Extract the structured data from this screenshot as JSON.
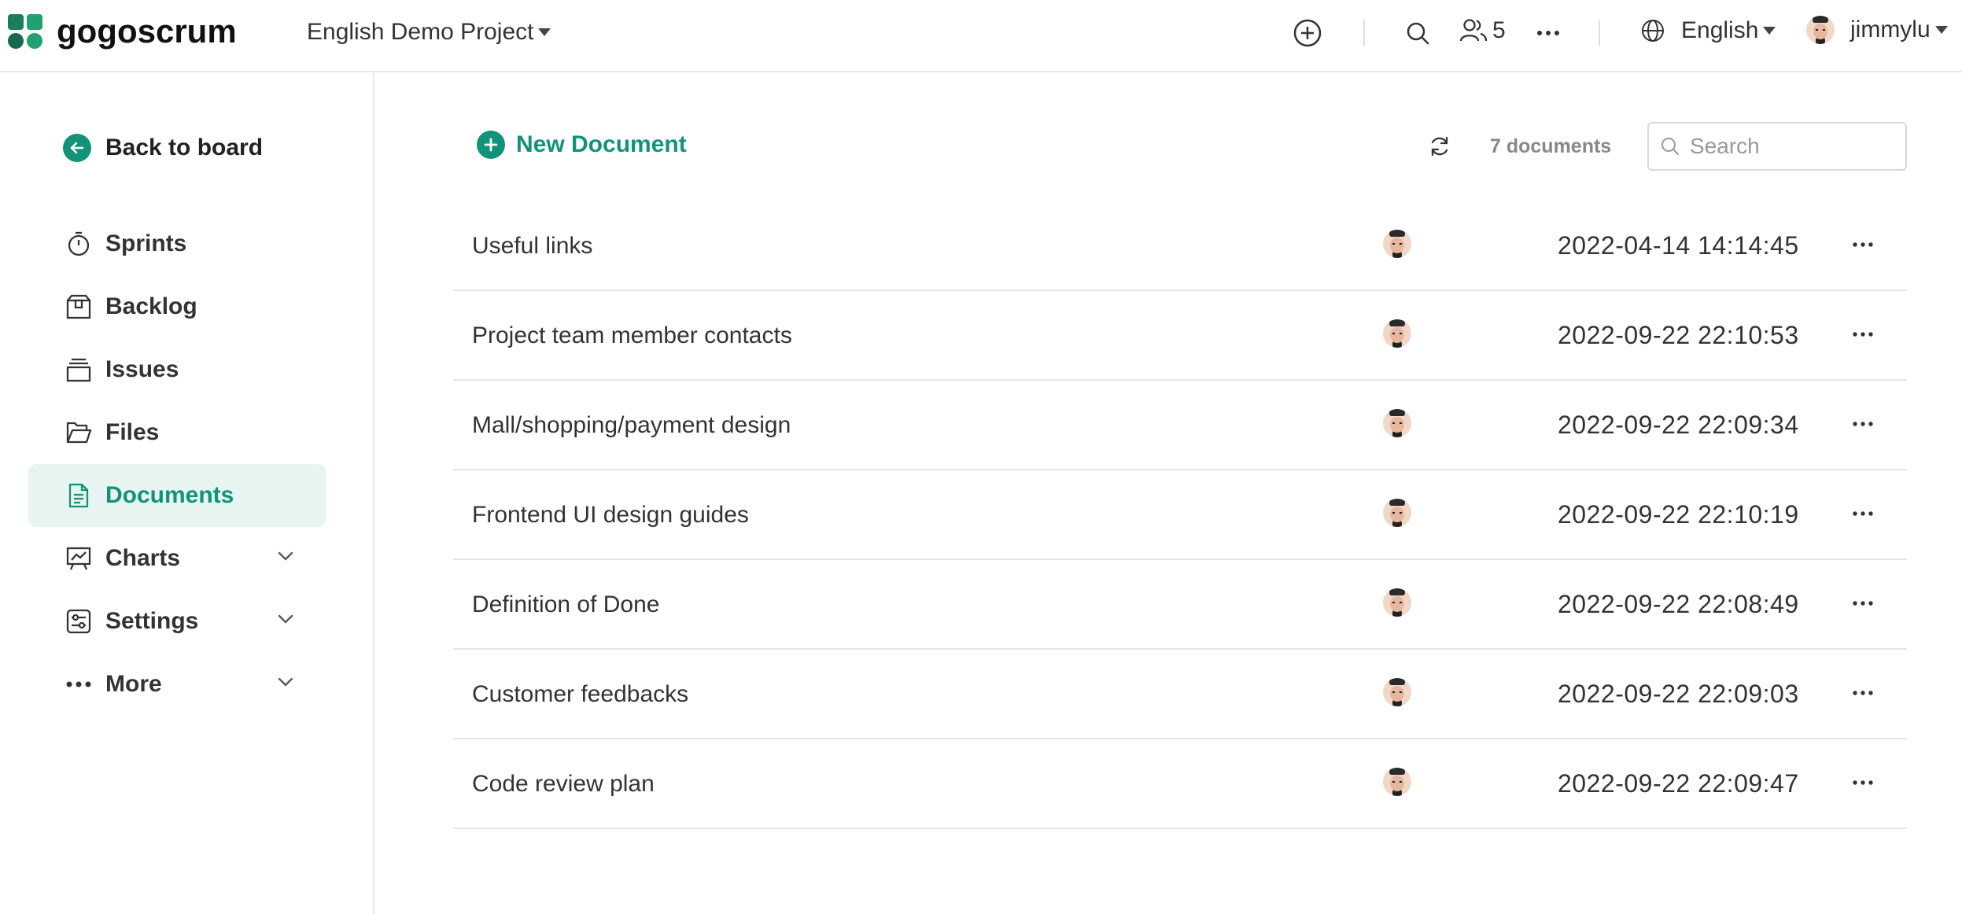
{
  "app": {
    "brand": "gogoscrum"
  },
  "header": {
    "project": "English Demo Project",
    "member_count": "5",
    "language": "English",
    "username": "jimmylu"
  },
  "sidebar": {
    "back_label": "Back to board",
    "items": [
      {
        "label": "Sprints",
        "icon": "timer-icon",
        "active": false,
        "expandable": false
      },
      {
        "label": "Backlog",
        "icon": "box-icon",
        "active": false,
        "expandable": false
      },
      {
        "label": "Issues",
        "icon": "stack-icon",
        "active": false,
        "expandable": false
      },
      {
        "label": "Files",
        "icon": "folder-icon",
        "active": false,
        "expandable": false
      },
      {
        "label": "Documents",
        "icon": "document-icon",
        "active": true,
        "expandable": false
      },
      {
        "label": "Charts",
        "icon": "chart-icon",
        "active": false,
        "expandable": true
      },
      {
        "label": "Settings",
        "icon": "settings-icon",
        "active": false,
        "expandable": true
      },
      {
        "label": "More",
        "icon": "dots-icon",
        "active": false,
        "expandable": true
      }
    ]
  },
  "toolbar": {
    "new_document_label": "New Document",
    "document_count": "7 documents",
    "search_placeholder": "Search"
  },
  "documents": [
    {
      "title": "Useful links",
      "updated": "2022-04-14 14:14:45"
    },
    {
      "title": "Project team member contacts",
      "updated": "2022-09-22 22:10:53"
    },
    {
      "title": "Mall/shopping/payment design",
      "updated": "2022-09-22 22:09:34"
    },
    {
      "title": "Frontend UI design guides",
      "updated": "2022-09-22 22:10:19"
    },
    {
      "title": "Definition of Done",
      "updated": "2022-09-22 22:08:49"
    },
    {
      "title": "Customer feedbacks",
      "updated": "2022-09-22 22:09:03"
    },
    {
      "title": "Code review plan",
      "updated": "2022-09-22 22:09:47"
    }
  ],
  "colors": {
    "accent": "#11937a",
    "active_bg": "#e8f4f1",
    "border": "#e6e6e6"
  }
}
